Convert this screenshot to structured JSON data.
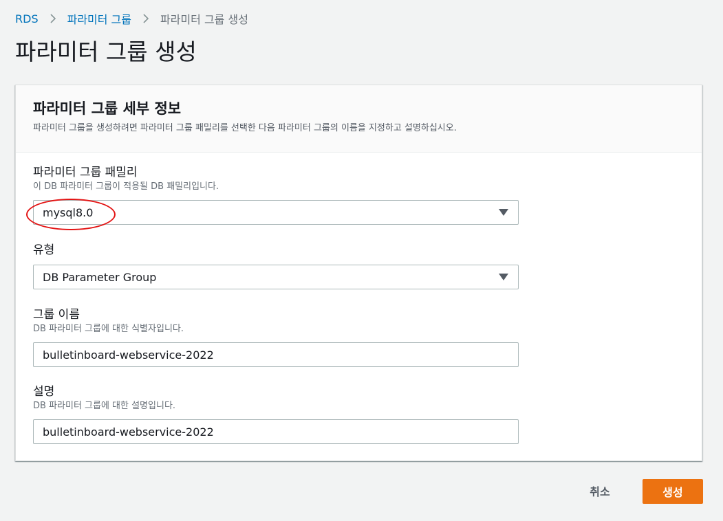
{
  "breadcrumb": {
    "items": [
      {
        "label": "RDS"
      },
      {
        "label": "파라미터 그룹"
      },
      {
        "label": "파라미터 그룹 생성"
      }
    ]
  },
  "page": {
    "title": "파라미터 그룹 생성"
  },
  "panel": {
    "title": "파라미터 그룹 세부 정보",
    "description": "파라미터 그룹을 생성하려면 파라미터 그룹 패밀리를 선택한 다음 파라미터 그룹의 이름을 지정하고 설명하십시오."
  },
  "form": {
    "family": {
      "label": "파라미터 그룹 패밀리",
      "hint": "이 DB 파라미터 그룹이 적용될 DB 패밀리입니다.",
      "value": "mysql8.0"
    },
    "type": {
      "label": "유형",
      "value": "DB Parameter Group"
    },
    "group_name": {
      "label": "그룹 이름",
      "hint": "DB 파라미터 그룹에 대한 식별자입니다.",
      "value": "bulletinboard-webservice-2022"
    },
    "description": {
      "label": "설명",
      "hint": "DB 파라미터 그룹에 대한 설명입니다.",
      "value": "bulletinboard-webservice-2022"
    }
  },
  "actions": {
    "cancel_label": "취소",
    "create_label": "생성"
  },
  "colors": {
    "link": "#0073bb",
    "primary_button": "#ec7211",
    "highlight": "#e31414",
    "background": "#f2f3f3"
  },
  "icons": {
    "breadcrumb_separator": "chevron-right-icon",
    "select_caret": "caret-down-icon"
  }
}
